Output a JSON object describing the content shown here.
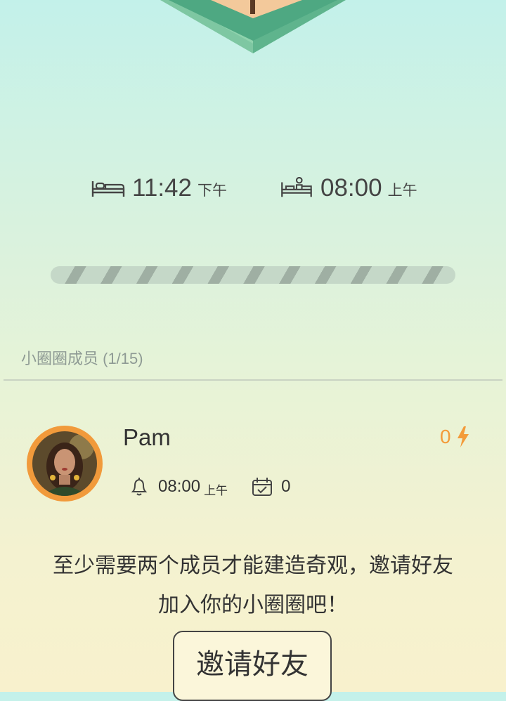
{
  "sleep": {
    "bedtime": {
      "time": "11:42",
      "ampm": "下午",
      "icon": "bed-icon"
    },
    "wake": {
      "time": "08:00",
      "ampm": "上午",
      "icon": "wake-up-icon"
    }
  },
  "progress": {
    "label": ""
  },
  "members": {
    "title": "小圈圈成员 (1/15)",
    "list": [
      {
        "name": "Pam",
        "score": "0",
        "alarm_time": "08:00",
        "alarm_ampm": "上午",
        "checkins": "0"
      }
    ]
  },
  "invite": {
    "message_line1": "至少需要两个成员才能建造奇观，邀请好友",
    "message_line2": "加入你的小圈圈吧！",
    "button_label": "邀请好友"
  },
  "colors": {
    "accent": "#f39b3a",
    "stripe_light": "#c5d8c8",
    "stripe_dark": "#9fafa3",
    "divider": "#c9d3c3"
  }
}
